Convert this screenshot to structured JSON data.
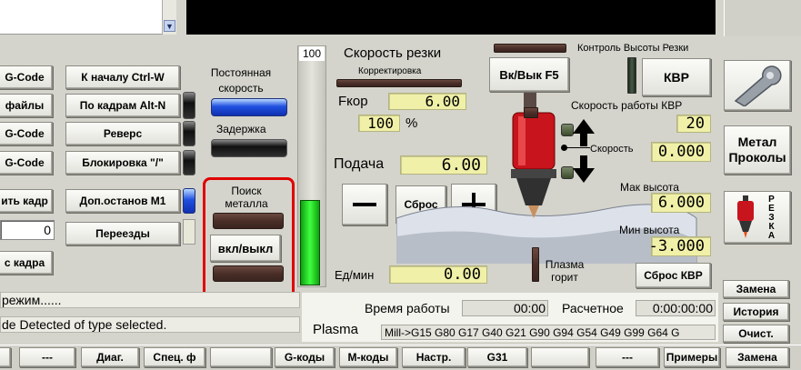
{
  "colors": {
    "background": "#d4d4cc",
    "dro_bg": "#f0f0a8",
    "highlight_frame": "#e00000",
    "led_blue": "#2050e0"
  },
  "left_buttons": [
    {
      "label": "G-Code"
    },
    {
      "label": "файлы"
    },
    {
      "label": "G-Code"
    },
    {
      "label": "G-Code"
    },
    {
      "label": "ить кадр"
    },
    {
      "label": "с кадра"
    }
  ],
  "left_value": "0",
  "middle_buttons": [
    {
      "label": "К началу Ctrl-W"
    },
    {
      "label": "По кадрам Alt-N"
    },
    {
      "label": "Реверс"
    },
    {
      "label": "Блокировка \"/\""
    },
    {
      "label": "Доп.останов M1"
    },
    {
      "label": "Переезды"
    }
  ],
  "constant_speed": {
    "label": "Постоянная скорость"
  },
  "delay": {
    "label": "Задержка"
  },
  "metal_search": {
    "label": "Поиск металла",
    "toggle_label": "вкл/выкл"
  },
  "slider": {
    "value": "100"
  },
  "cut_speed": {
    "title": "Скорость резки",
    "correction_label": "Корректировка",
    "fkor_label": "Fкор",
    "fkor_value": "6.00",
    "percent_value": "100",
    "percent_unit": "%",
    "feed_label": "Подача",
    "feed_value": "6.00",
    "minus_icon": "minus-icon",
    "reset_label": "Сброс",
    "plus_icon": "plus-icon",
    "units_label": "Ед/мин",
    "units_value": "0.00"
  },
  "thc": {
    "title": "Контроль Высоты Резки",
    "toggle_label": "Вк/Вык F5",
    "kvr_label": "КВР",
    "speed_label": "Скорость работы КВР",
    "speed_value": "20",
    "torch_speed_label": "Скорость",
    "torch_speed_value": "0.000",
    "max_label": "Мак высота",
    "max_value": "6.000",
    "min_label": "Мин высота",
    "min_value": "-3.000",
    "plasma_label": "Плазма горит",
    "reset_label": "Сброс КВР"
  },
  "right_buttons": {
    "tool_icon": "wrench-icon",
    "metal_label": "Метал Проколы",
    "cut_mode_label": "РЕЗКА",
    "torch_icon": "torch-icon",
    "replace_label": "Замена",
    "history_label": "История",
    "clear_label": "Очист.",
    "replace2_label": "Замена"
  },
  "status": {
    "mode_text": "режим......",
    "message_text": "de Detected of type selected.",
    "runtime_label": "Время работы",
    "runtime_value": "00:00",
    "estimate_label": "Расчетное",
    "estimate_value": "0:00:00:00",
    "profile_label": "Plasma",
    "modal_codes": "Mill->G15  G80 G17 G40 G21 G90 G94 G54 G49 G99 G64 G"
  },
  "bottom_tabs": [
    {
      "label": ""
    },
    {
      "label": "---"
    },
    {
      "label": "Диаг."
    },
    {
      "label": "Спец. ф"
    },
    {
      "label": ""
    },
    {
      "label": "G-коды"
    },
    {
      "label": "M-коды"
    },
    {
      "label": "Настр."
    },
    {
      "label": "G31"
    },
    {
      "label": ""
    },
    {
      "label": "---"
    },
    {
      "label": "Примеры"
    }
  ]
}
